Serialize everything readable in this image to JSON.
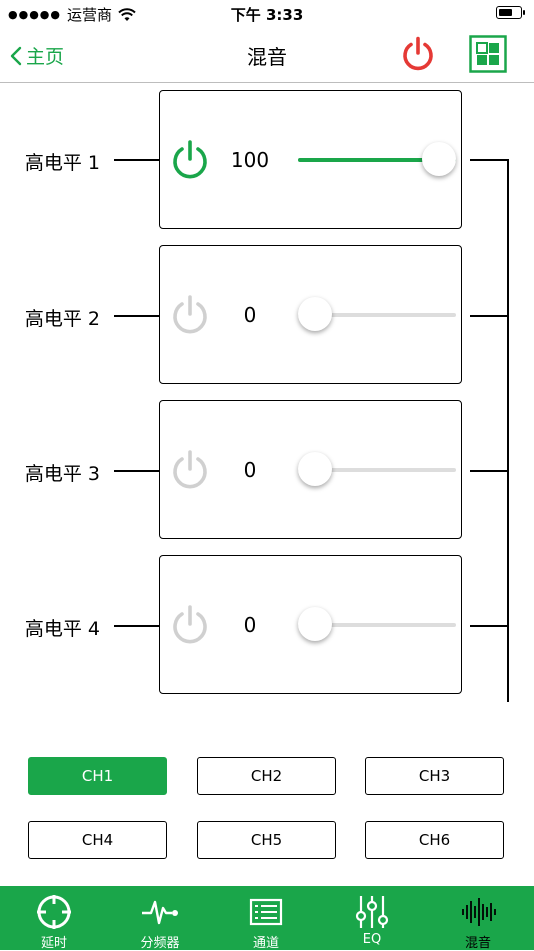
{
  "status_bar": {
    "carrier": "运营商",
    "time": "下午 3:33",
    "battery_level": 0.7
  },
  "nav": {
    "back_label": "主页",
    "title": "混音"
  },
  "colors": {
    "accent": "#1aa64a",
    "power_red": "#e53935",
    "disabled": "#d0d0d0"
  },
  "channels": [
    {
      "label": "高电平 1",
      "value": "100",
      "level": 1.0,
      "enabled": true
    },
    {
      "label": "高电平 2",
      "value": "0",
      "level": 0.0,
      "enabled": false
    },
    {
      "label": "高电平 3",
      "value": "0",
      "level": 0.0,
      "enabled": false
    },
    {
      "label": "高电平 4",
      "value": "0",
      "level": 0.0,
      "enabled": false
    }
  ],
  "ch_buttons": [
    {
      "label": "CH1",
      "active": true
    },
    {
      "label": "CH2",
      "active": false
    },
    {
      "label": "CH3",
      "active": false
    },
    {
      "label": "CH4",
      "active": false
    },
    {
      "label": "CH5",
      "active": false
    },
    {
      "label": "CH6",
      "active": false
    }
  ],
  "tabs": [
    {
      "label": "延时",
      "icon": "crosshair-icon"
    },
    {
      "label": "分频器",
      "icon": "waveform-icon"
    },
    {
      "label": "通道",
      "icon": "list-icon"
    },
    {
      "label": "EQ",
      "icon": "sliders-icon"
    },
    {
      "label": "混音",
      "icon": "audio-bars-icon"
    }
  ]
}
